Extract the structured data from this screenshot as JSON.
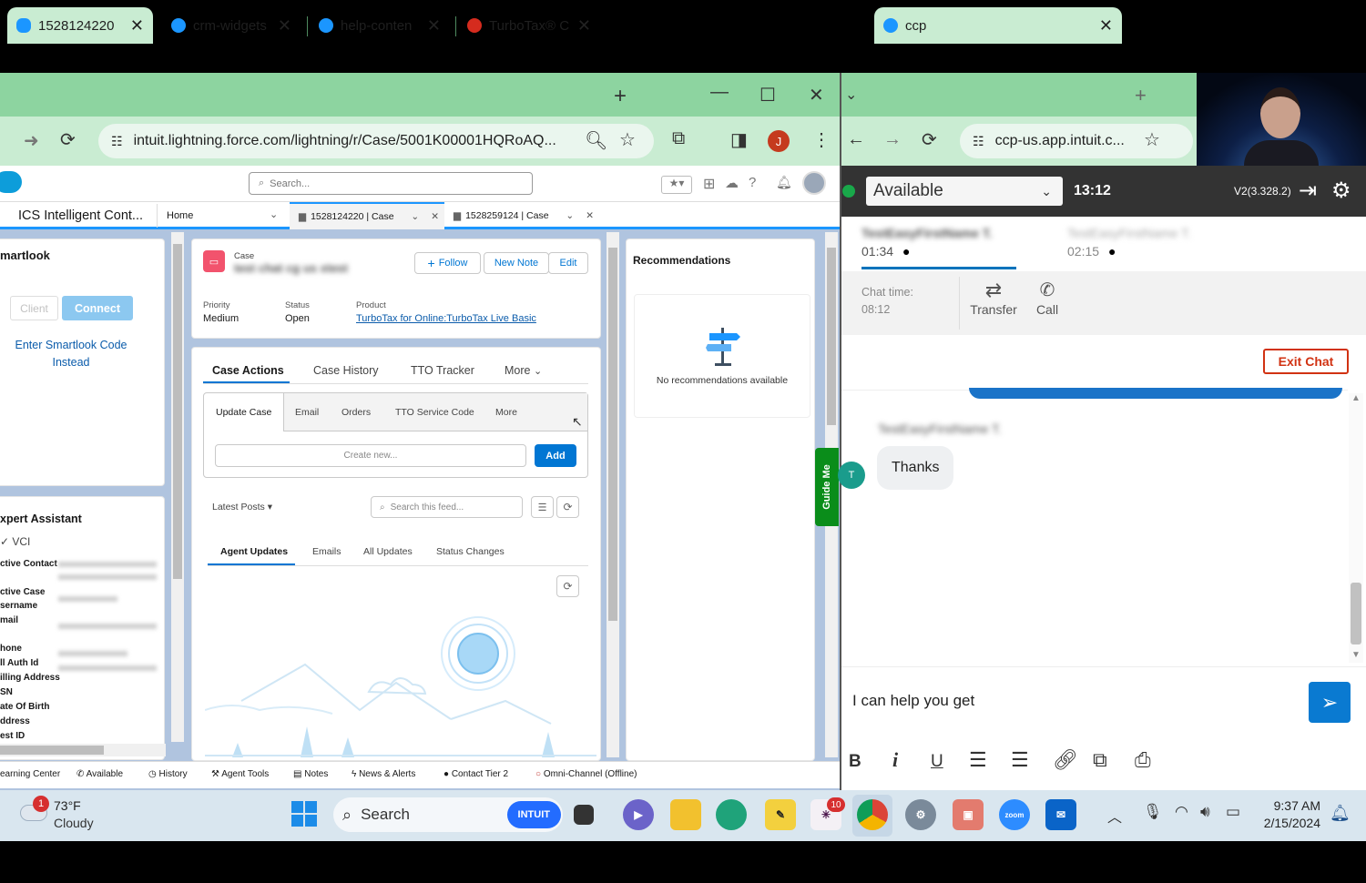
{
  "chrome_left": {
    "tabs": [
      {
        "title": "1528124220",
        "favicon_color": "#1b96ff"
      },
      {
        "title": "crm-widgets",
        "favicon_color": "#1b96ff"
      },
      {
        "title": "help-conten",
        "favicon_color": "#1b96ff"
      },
      {
        "title": "TurboTax® C",
        "favicon_color": "#d52b1e"
      }
    ],
    "url": "intuit.lightning.force.com/lightning/r/Case/5001K00001HQRoAQ...",
    "profile_letter": "J"
  },
  "chrome_right": {
    "tab_title": "ccp",
    "url": "ccp-us.app.intuit.c..."
  },
  "salesforce": {
    "search_placeholder": "Search...",
    "app_name": "ICS Intelligent Cont...",
    "nav_home": "Home",
    "workspace_tabs": [
      "1528124220 | Case",
      "1528259124 | Case"
    ],
    "smartlook": {
      "title": "martlook",
      "client_label": "Client",
      "connect_label": "Connect",
      "enter_code_line1": "Enter Smartlook Code",
      "enter_code_line2": "Instead"
    },
    "expert_assistant": {
      "title": "xpert Assistant",
      "vci": "VCI",
      "fields": [
        "ctive Contact",
        "ctive Case",
        "sername",
        "mail",
        "hone",
        "ll Auth Id",
        "illing Address",
        "SN",
        "ate Of Birth",
        "ddress",
        "est ID"
      ]
    },
    "case": {
      "type_label": "Case",
      "title": "test chat cg us xtest",
      "follow_label": "Follow",
      "new_note_label": "New Note",
      "edit_label": "Edit",
      "priority_label": "Priority",
      "priority_value": "Medium",
      "status_label": "Status",
      "status_value": "Open",
      "product_label": "Product",
      "product_value": "TurboTax for Online:TurboTax Live Basic"
    },
    "case_tabs": [
      "Case Actions",
      "Case History",
      "TTO Tracker",
      "More"
    ],
    "action_tabs": [
      "Update Case",
      "Email",
      "Orders",
      "TTO Service Code",
      "More"
    ],
    "create_new_placeholder": "Create new...",
    "add_label": "Add",
    "latest_posts": "Latest Posts",
    "search_feed_placeholder": "Search this feed...",
    "feed_tabs": [
      "Agent Updates",
      "Emails",
      "All Updates",
      "Status Changes"
    ],
    "recommendations": {
      "title": "Recommendations",
      "empty": "No recommendations available"
    },
    "guide_me": "Guide Me",
    "utility_bar": [
      "earning Center",
      "Available",
      "History",
      "Agent Tools",
      "Notes",
      "News & Alerts",
      "Contact Tier 2",
      "Omni-Channel (Offline)"
    ]
  },
  "ccp": {
    "status": "Available",
    "timer": "13:12",
    "version": "V2(3.328.2)",
    "contacts": [
      {
        "name": "TestEasyFirstName T.",
        "time": "01:34"
      },
      {
        "name": "TestEasyFirstName T.",
        "time": "02:15"
      }
    ],
    "chat_time_label": "Chat time:",
    "chat_time_value": "08:12",
    "transfer_label": "Transfer",
    "call_label": "Call",
    "exit_chat_label": "Exit Chat",
    "sender_name": "TestEasyFirstName T.",
    "avatar_letter": "T",
    "message": "Thanks",
    "compose_text": "I can help you get"
  },
  "taskbar": {
    "weather_temp": "73°F",
    "weather_desc": "Cloudy",
    "weather_badge": "1",
    "search_label": "Search",
    "intuit_label": "INTUIT",
    "slack_badge": "10",
    "zoom_label": "zoom",
    "time": "9:37 AM",
    "date": "2/15/2024"
  }
}
